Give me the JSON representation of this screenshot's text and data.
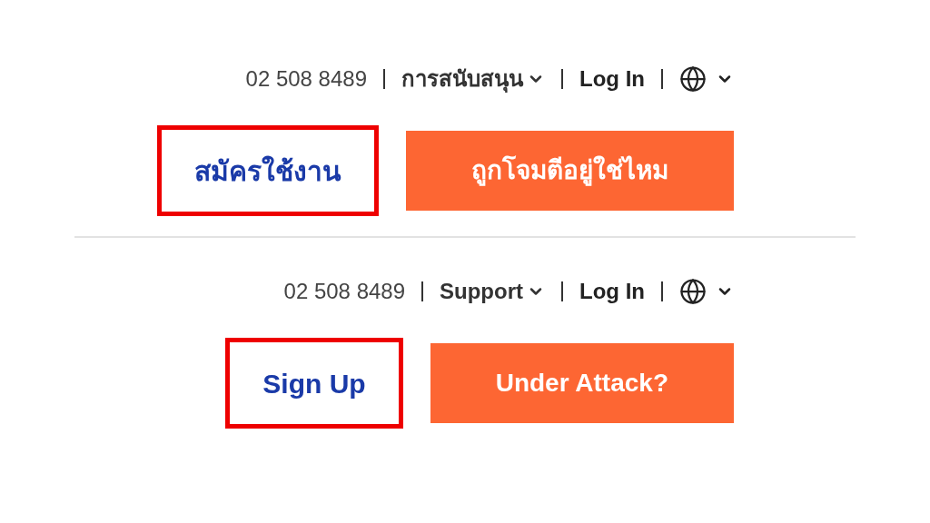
{
  "panels": [
    {
      "phone": "02 508 8489",
      "support": "การสนับสนุน",
      "login": "Log In",
      "signup": {
        "label": "สมัครใช้งาน",
        "highlighted": true
      },
      "attack_button": "ถูกโจมตีอยู่ใช่ไหม"
    },
    {
      "phone": "02 508 8489",
      "support": "Support",
      "login": "Log In",
      "signup": {
        "label": "Sign Up",
        "highlighted": true
      },
      "attack_button": "Under Attack?"
    }
  ]
}
